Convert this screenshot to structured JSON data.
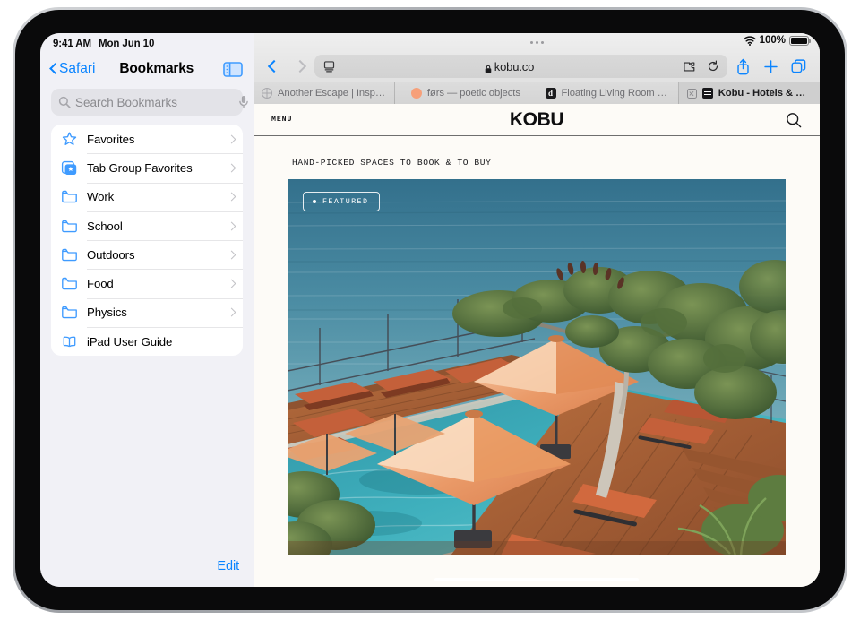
{
  "status_bar": {
    "time": "9:41 AM",
    "date": "Mon Jun 10",
    "battery_percent": "100%",
    "wifi_icon": "wifi-icon",
    "battery_icon": "battery-icon"
  },
  "sidebar": {
    "back_label": "Safari",
    "title": "Bookmarks",
    "toggle_icon": "sidebar-toggle-icon",
    "search": {
      "placeholder": "Search Bookmarks",
      "value": "",
      "search_icon": "search-icon",
      "mic_icon": "microphone-icon"
    },
    "items": [
      {
        "label": "Favorites",
        "icon": "star-icon",
        "has_chevron": true
      },
      {
        "label": "Tab Group Favorites",
        "icon": "tab-group-star-icon",
        "has_chevron": true
      },
      {
        "label": "Work",
        "icon": "folder-icon",
        "has_chevron": true
      },
      {
        "label": "School",
        "icon": "folder-icon",
        "has_chevron": true
      },
      {
        "label": "Outdoors",
        "icon": "folder-icon",
        "has_chevron": true
      },
      {
        "label": "Food",
        "icon": "folder-icon",
        "has_chevron": true
      },
      {
        "label": "Physics",
        "icon": "folder-icon",
        "has_chevron": true
      },
      {
        "label": "iPad User Guide",
        "icon": "book-icon",
        "has_chevron": false
      }
    ],
    "edit_label": "Edit"
  },
  "toolbar": {
    "back_icon": "chevron-left-icon",
    "forward_icon": "chevron-right-icon",
    "page_settings_icon": "page-settings-icon",
    "lock_icon": "lock-icon",
    "url": "kobu.co",
    "extensions_icon": "extensions-puzzle-icon",
    "reload_icon": "reload-icon",
    "share_icon": "share-icon",
    "new_tab_icon": "plus-icon",
    "tab_overview_icon": "tab-overview-icon"
  },
  "tabs": [
    {
      "title": "Another Escape | Inspir…",
      "favicon": "globe-icon",
      "active": false
    },
    {
      "title": "førs — poetic objects",
      "favicon": "orange-dot-icon",
      "active": false
    },
    {
      "title": "Floating Living Room Se…",
      "favicon": "dwell-d-icon",
      "active": false
    },
    {
      "title": "Kobu - Hotels & Propert…",
      "favicon": "kobu-icon",
      "active": true
    }
  ],
  "page": {
    "menu_label": "MENU",
    "logo": "KOBU",
    "search_icon": "search-icon",
    "tagline": "HAND-PICKED SPACES TO BOOK & TO BUY",
    "hero": {
      "badge_label": "FEATURED",
      "badge_dot": "dot-icon",
      "alt": "Infinity pool terrace overlooking the ocean with orange umbrellas and loungers"
    }
  },
  "colors": {
    "accent_blue": "#0a84ff",
    "page_bg": "#fdfbf7",
    "ocean": "#3f7f97",
    "umbrella_orange": "#e8986a",
    "deck_wood": "#a5603a"
  }
}
